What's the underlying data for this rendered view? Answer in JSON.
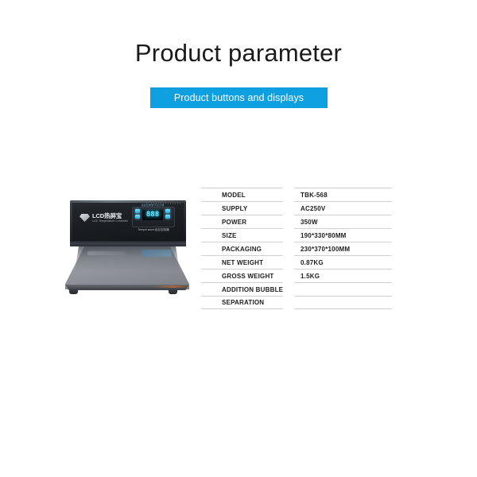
{
  "header": {
    "title": "Product parameter",
    "banner_label": "Product buttons and displays",
    "banner_color": "#0e9fe0"
  },
  "product_image": {
    "alt_name": "lcd-separator-machine",
    "logo_main": "LCD热屏宝",
    "logo_sub": "LCD Temperature Controller",
    "display_caption": "温度控制数字显示器",
    "display_value": "888",
    "footer_text": "Temperature设定控制器",
    "led_color": "#67e6ff"
  },
  "spec_table": {
    "rows": [
      {
        "key": "MODEL",
        "value": "TBK-568"
      },
      {
        "key": "SUPPLY",
        "value": "AC250V"
      },
      {
        "key": "POWER",
        "value": "350W"
      },
      {
        "key": "SIZE",
        "value": "190*330*80MM"
      },
      {
        "key": "PACKAGING",
        "value": "230*370*100MM"
      },
      {
        "key": "NET WEIGHT",
        "value": "0.87KG"
      },
      {
        "key": "GROSS WEIGHT",
        "value": "1.5KG"
      },
      {
        "key": "ADDITION BUBBLE",
        "value": ""
      },
      {
        "key": "SEPARATION",
        "value": ""
      }
    ]
  }
}
